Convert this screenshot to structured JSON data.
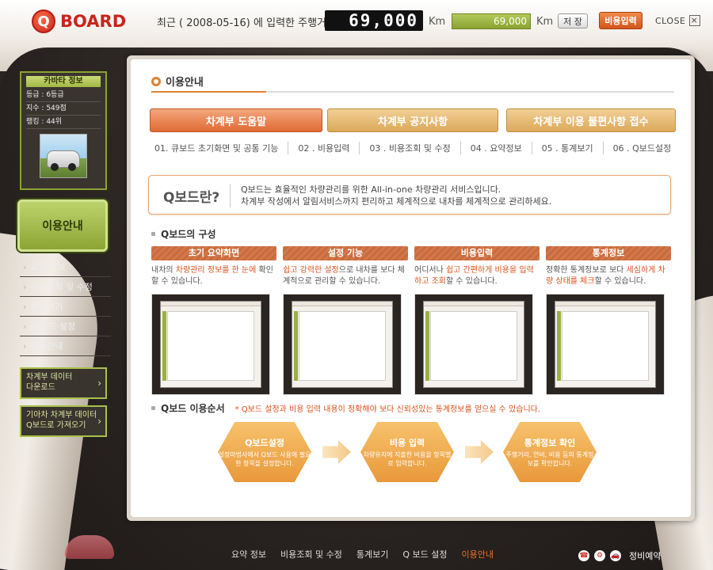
{
  "header": {
    "logo_q": "Q",
    "logo_text": "BOARD",
    "recent_label": "최근 ( 2008-05-16) 에 입력한 주행거리 :",
    "odometer": "69,000",
    "km1": "Km",
    "mileage_value": "69,000",
    "km2": "Km",
    "save_label": "저 장",
    "cost_input_label": "비용입력",
    "close_label": "CLOSE",
    "close_x": "×"
  },
  "avatar": {
    "title": "카바타 정보",
    "grade": "등급 : 6등급",
    "knowledge": "지수 : 549점",
    "ranking": "랭킹 : 44위"
  },
  "sidebar": {
    "main": "이용안내",
    "items": [
      {
        "label": "요약 정보"
      },
      {
        "label": "비용조회 및 수정"
      },
      {
        "label": "통계보기"
      },
      {
        "label": "Q 보드 설정"
      },
      {
        "label": "이용안내"
      }
    ],
    "btn1_line1": "차계부 데이터",
    "btn1_line2": "다운로드",
    "btn2_line1": "기아차 차계부 데이터",
    "btn2_line2": "Q보드로 가져오기",
    "arrow": "›"
  },
  "main": {
    "title": "이용안내",
    "tabs": [
      {
        "label": "차계부 도움말"
      },
      {
        "label": "차계부 공지사항"
      },
      {
        "label": "차계부 이용 불편사항 접수"
      }
    ],
    "subnav": [
      "01. 큐보드 초기화면 및 공통 기능",
      "02 . 비용입력",
      "03 . 비용조회 및 수정",
      "04 . 요약정보",
      "05 . 통계보기",
      "06 . Q보드설정"
    ],
    "qbox": {
      "title": "Q보드란?",
      "line1": "Q보드는 효율적인 차량관리를 위한 All-in-one 차량관리 서비스입니다.",
      "line2": "차계부 작성에서 알림서비스까지 편리하고 체계적으로 내차를 체계적으로 관리하세요."
    },
    "composition": {
      "heading": "Q보드의 구성",
      "cols": [
        {
          "head": "초기 요약화면",
          "desc_a": "내차의 ",
          "desc_hl": "차량관리 정보를 한 눈에",
          "desc_b": " 확인할 수 있습니다."
        },
        {
          "head": "설정 기능",
          "desc_a": "",
          "desc_hl": "쉽고 강력한 설정",
          "desc_b": "으로 내차를 보다 체계적으로 관리할 수 있습니다."
        },
        {
          "head": "비용입력",
          "desc_a": "어디서나 ",
          "desc_hl": "쉽고 간편하게 비용을 입력하고 조회",
          "desc_b": "할 수 있습니다."
        },
        {
          "head": "통계정보",
          "desc_a": "정확한 통계정보로 보다 ",
          "desc_hl": "세심하게 차량 상태를 체크",
          "desc_b": "할 수 있습니다."
        }
      ]
    },
    "order": {
      "heading": "Q보드 이용순서",
      "note": "* Q보드 설정과 비용 입력 내용이 정확해야 보다 신뢰성있는 통계정보를 얻으실 수 있습니다.",
      "steps": [
        {
          "title": "Q보드설정",
          "desc": "설정마법사에서 Q보드 사용에 필요한 항목을 설정합니다."
        },
        {
          "title": "비용 입력",
          "desc": "차량유지에 지출한 비용을 항목별로 입력합니다."
        },
        {
          "title": "통계정보 확인",
          "desc": "주행거리, 연비, 비용 등의 통계정보를 확인합니다."
        }
      ]
    }
  },
  "bottom_nav": {
    "items": [
      {
        "label": "요약 정보"
      },
      {
        "label": "비용조회 및 수정"
      },
      {
        "label": "통계보기"
      },
      {
        "label": "Q 보드 설정"
      },
      {
        "label": "이용안내"
      }
    ],
    "service_label": "정비예약",
    "icon_phone": "☎",
    "icon_gear": "⚙",
    "icon_car": "🚗"
  },
  "colors": {
    "accent": "#e08235",
    "brand_red": "#c8251a",
    "green": "#8aa330"
  }
}
